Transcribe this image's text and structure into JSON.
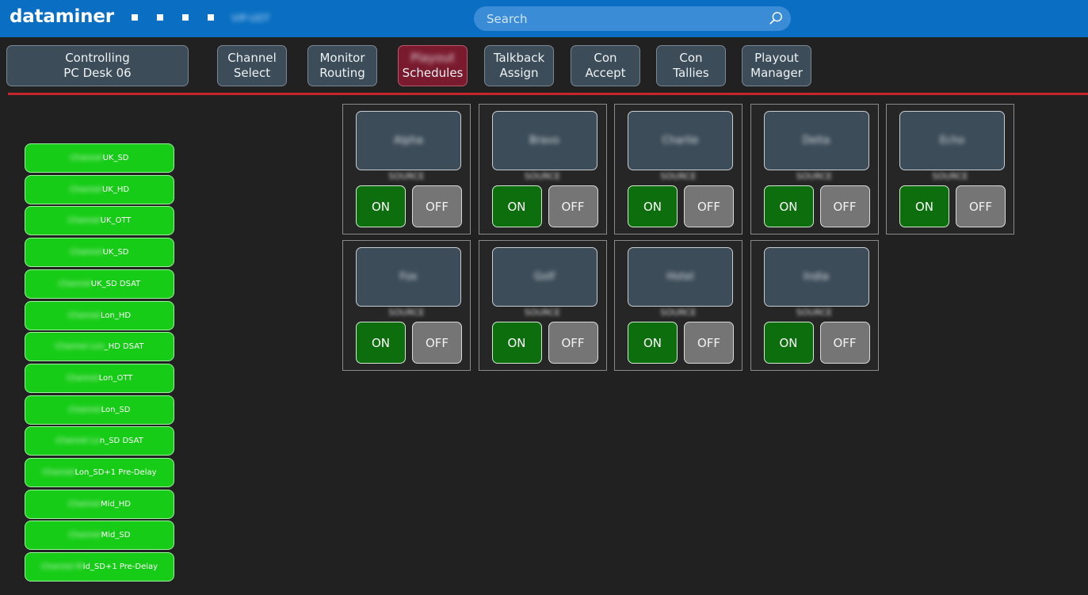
{
  "header": {
    "logo": "dataminer",
    "title_blurred": "VIP-UDT",
    "search_placeholder": "Search",
    "search_icon": "search-icon"
  },
  "nav": [
    {
      "line1": "Controlling",
      "line2": "PC Desk 06",
      "active": false
    },
    {
      "line1": "Channel",
      "line2": "Select",
      "active": false
    },
    {
      "line1": "Monitor",
      "line2": "Routing",
      "active": false
    },
    {
      "line1": "Playout",
      "line2": "Schedules",
      "active": true
    },
    {
      "line1": "Talkback",
      "line2": "Assign",
      "active": false
    },
    {
      "line1": "Con",
      "line2": "Accept",
      "active": false
    },
    {
      "line1": "Con",
      "line2": "Tallies",
      "active": false
    },
    {
      "line1": "Playout",
      "line2": "Manager",
      "active": false
    }
  ],
  "channels": [
    {
      "prefix": "Channel",
      "suffix": "UK_SD"
    },
    {
      "prefix": "Channel",
      "suffix": "UK_HD"
    },
    {
      "prefix": "Channel",
      "suffix": "UK_OTT"
    },
    {
      "prefix": "Channel",
      "suffix": "UK_SD"
    },
    {
      "prefix": "Channel",
      "suffix": "UK_SD DSAT"
    },
    {
      "prefix": "Channel",
      "suffix": "Lon_HD"
    },
    {
      "prefix": "Channel Lon",
      "suffix": "_HD DSAT"
    },
    {
      "prefix": "Channel",
      "suffix": "Lon_OTT"
    },
    {
      "prefix": "Channel",
      "suffix": "Lon_SD"
    },
    {
      "prefix": "Channel Lo",
      "suffix": "n_SD DSAT"
    },
    {
      "prefix": "Channel",
      "suffix": "Lon_SD+1 Pre-Delay"
    },
    {
      "prefix": "Channel",
      "suffix": "Mid_HD"
    },
    {
      "prefix": "Channel",
      "suffix": "Mid_SD"
    },
    {
      "prefix": "Channel M",
      "suffix": "id_SD+1 Pre-Delay"
    }
  ],
  "cards": [
    {
      "name": "Alpha",
      "sub": "SOURCE",
      "on": "ON",
      "off": "OFF"
    },
    {
      "name": "Bravo",
      "sub": "SOURCE",
      "on": "ON",
      "off": "OFF"
    },
    {
      "name": "Charlie",
      "sub": "SOURCE",
      "on": "ON",
      "off": "OFF"
    },
    {
      "name": "Delta",
      "sub": "SOURCE",
      "on": "ON",
      "off": "OFF"
    },
    {
      "name": "Echo",
      "sub": "SOURCE",
      "on": "ON",
      "off": "OFF"
    },
    {
      "name": "Fox",
      "sub": "SOURCE",
      "on": "ON",
      "off": "OFF"
    },
    {
      "name": "Golf",
      "sub": "SOURCE",
      "on": "ON",
      "off": "OFF"
    },
    {
      "name": "Hotel",
      "sub": "SOURCE",
      "on": "ON",
      "off": "OFF"
    },
    {
      "name": "India",
      "sub": "SOURCE",
      "on": "ON",
      "off": "OFF"
    }
  ],
  "colors": {
    "topbar": "#0a6fc2",
    "accent_red": "#c4262e",
    "channel_green": "#16cc16",
    "on_green": "#0c6e0c",
    "off_grey": "#757575"
  }
}
